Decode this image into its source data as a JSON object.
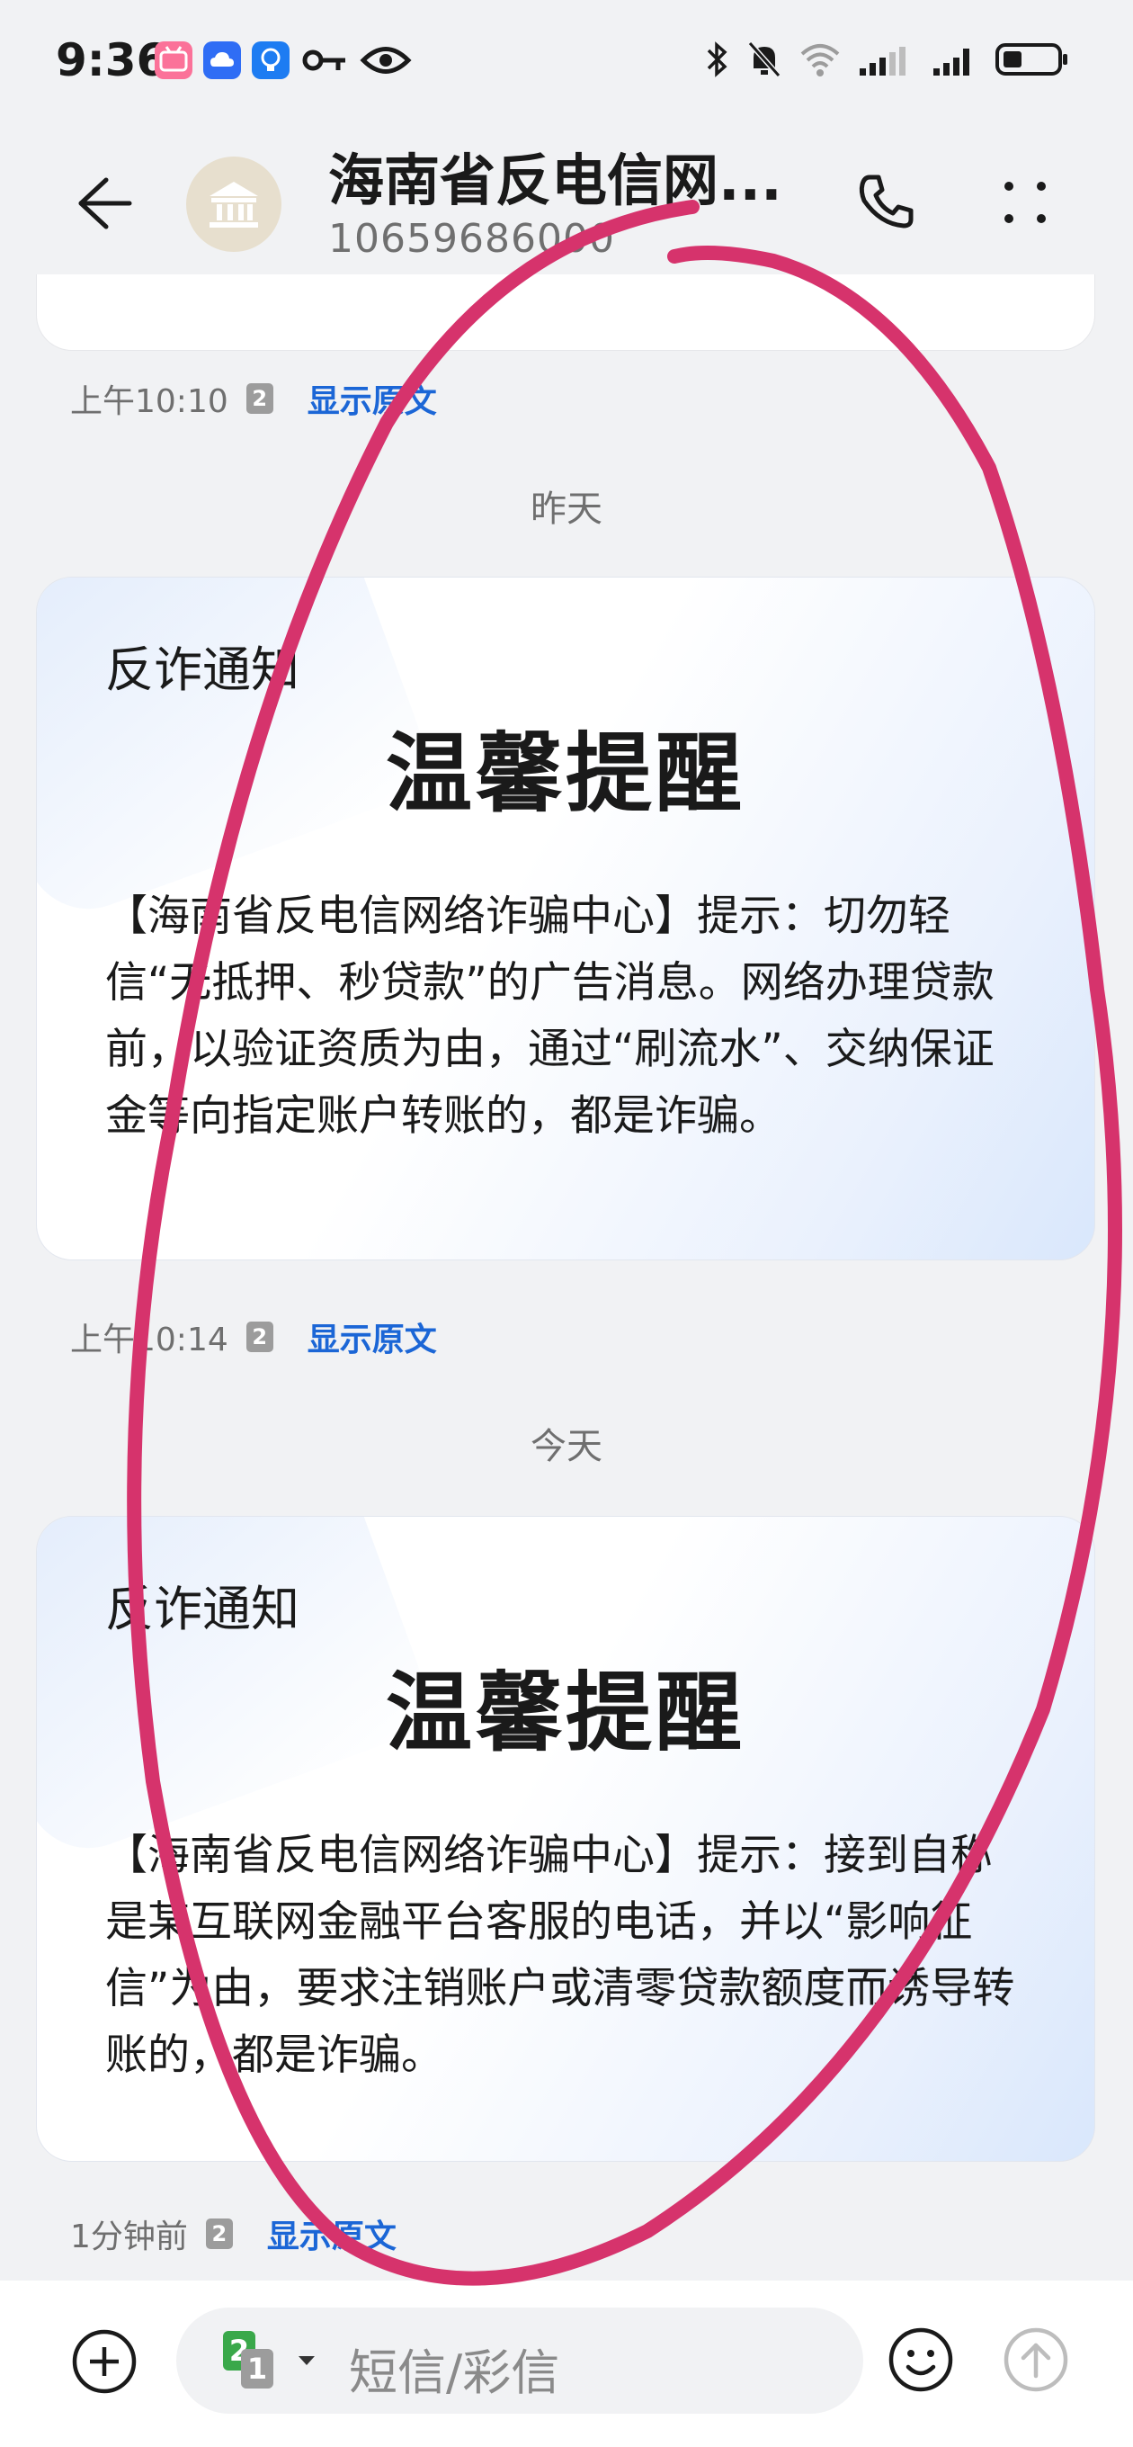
{
  "status_bar": {
    "time": "9:36",
    "app_icons": [
      "bilibili-icon",
      "cloud-app-icon",
      "bulb-app-icon",
      "key-icon",
      "eye-icon"
    ],
    "system_icons": [
      "bluetooth-icon",
      "mute-bell-icon",
      "wifi-icon",
      "signal-icon",
      "signal-icon",
      "battery-icon"
    ]
  },
  "header": {
    "title": "海南省反电信网...",
    "number": "10659686000",
    "avatar_icon": "bank-icon"
  },
  "messages": [
    {
      "time": "上午10:10",
      "sim": "2",
      "show_original": "显示原文"
    }
  ],
  "date_separators": {
    "yesterday": "昨天",
    "today": "今天"
  },
  "cards": [
    {
      "label": "反诈通知",
      "title": "温馨提醒",
      "body": "【海南省反电信网络诈骗中心】提示：切勿轻信“无抵押、秒贷款”的广告消息。网络办理贷款前，以验证资质为由，通过“刷流水”、交纳保证金等向指定账户转账的，都是诈骗。",
      "time": "上午10:14",
      "sim": "2",
      "show_original": "显示原文"
    },
    {
      "label": "反诈通知",
      "title": "温馨提醒",
      "body": "【海南省反电信网络诈骗中心】提示：接到自称是某互联网金融平台客服的电话，并以“影响征信”为由，要求注销账户或清零贷款额度而诱导转账的，都是诈骗。",
      "time": "1分钟前",
      "sim": "2",
      "show_original": "显示原文"
    }
  ],
  "input_bar": {
    "placeholder": "短信/彩信",
    "sim_primary": "2",
    "sim_secondary": "1"
  },
  "colors": {
    "accent": "#1b66d6",
    "annotation": "#d6336c",
    "background": "#f1f2f4"
  }
}
